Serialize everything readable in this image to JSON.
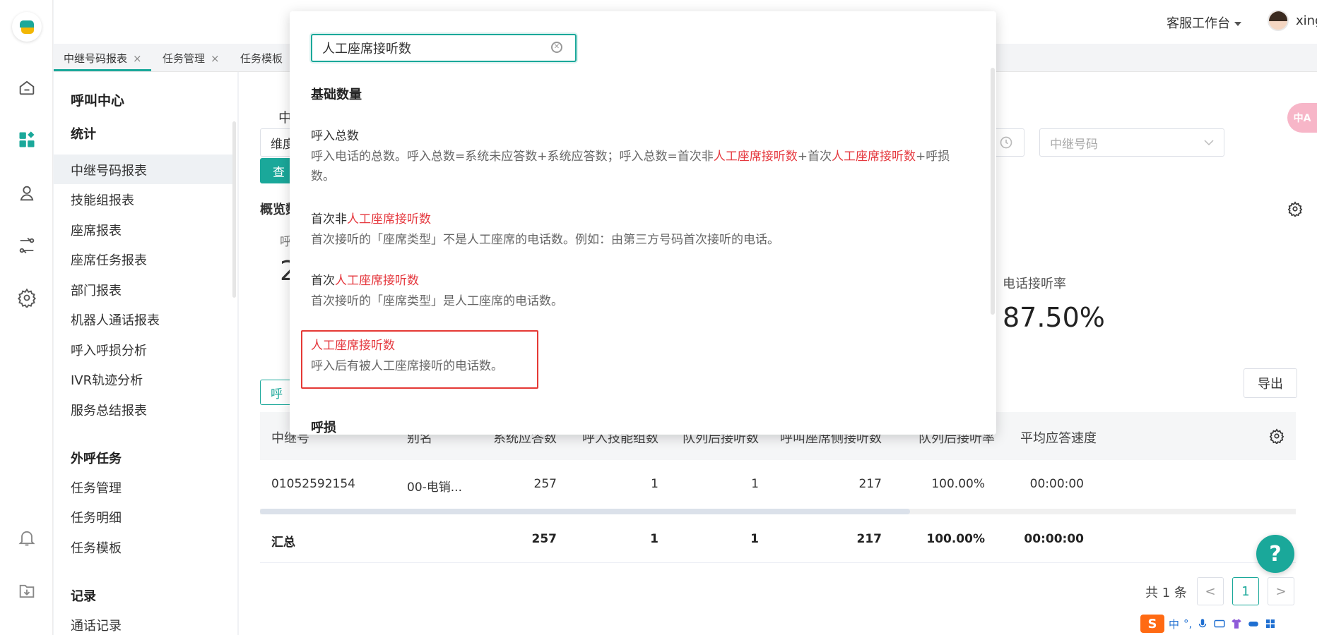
{
  "header": {
    "workspace_label": "客服工作台",
    "username": "xingze"
  },
  "tabs": [
    {
      "label": "中继号码报表",
      "close": "×"
    },
    {
      "label": "任务管理",
      "close": "×"
    },
    {
      "label": "任务模板"
    }
  ],
  "sidebar": {
    "title": "呼叫中心",
    "group1": "统计",
    "items1": [
      "中继号码报表",
      "技能组报表",
      "座席报表",
      "座席任务报表",
      "部门报表",
      "机器人通话报表",
      "呼入呼损分析",
      "IVR轨迹分析",
      "服务总结报表"
    ],
    "group2": "外呼任务",
    "items2": [
      "任务管理",
      "任务明细",
      "任务模板"
    ],
    "group3": "记录",
    "items3": [
      "通话记录"
    ]
  },
  "main": {
    "header_fragment": "中",
    "dimension_fragment": "维度",
    "query_fragment": "查",
    "overview_fragment": "概览数",
    "stat_label_fragment": "呼",
    "stat_value_fragment": "2",
    "tab_fragment": "呼",
    "trunk_select_placeholder": "中继号码",
    "rate_label": "电话接听率",
    "rate_value": "87.50%",
    "export_label": "导出",
    "table": {
      "headers": [
        "中继号",
        "别名",
        "系统应答数",
        "呼入技能组数",
        "队列后接听数",
        "呼叫座席侧接听数",
        "队列后接听率",
        "平均应答速度"
      ],
      "row": [
        "01052592154",
        "00-电销...",
        "257",
        "1",
        "1",
        "217",
        "100.00%",
        "00:00:00"
      ],
      "summary": [
        "汇总",
        "257",
        "1",
        "1",
        "217",
        "100.00%",
        "00:00:00"
      ]
    },
    "pager": {
      "total": "共 1 条",
      "current": "1",
      "prev": "<",
      "next": ">"
    }
  },
  "popup": {
    "search_value": "人工座席接听数",
    "section_title": "基础数量",
    "items": [
      {
        "title": "呼入总数",
        "desc_a": "呼入电话的总数。呼入总数=系统未应答数+系统应答数；呼入总数=首次非",
        "desc_hl1": "人工座席接听数",
        "desc_b": "+首次",
        "desc_hl2": "人工座席接听数",
        "desc_c": "+呼损数。"
      },
      {
        "title_a": "首次非",
        "title_hl": "人工座席接听数",
        "desc": "首次接听的「座席类型」不是人工座席的电话数。例如：由第三方号码首次接听的电话。"
      },
      {
        "title_a": "首次",
        "title_hl": "人工座席接听数",
        "desc": "首次接听的「座席类型」是人工座席的电话数。"
      },
      {
        "title_hl": "人工座席接听数",
        "desc": "呼入后有被人工座席接听的电话数。"
      }
    ],
    "next_section": "呼损"
  },
  "help_label": "?",
  "translate_label": "中A",
  "tray": {
    "ime": "S",
    "lang": "中",
    "punct": "°,"
  }
}
